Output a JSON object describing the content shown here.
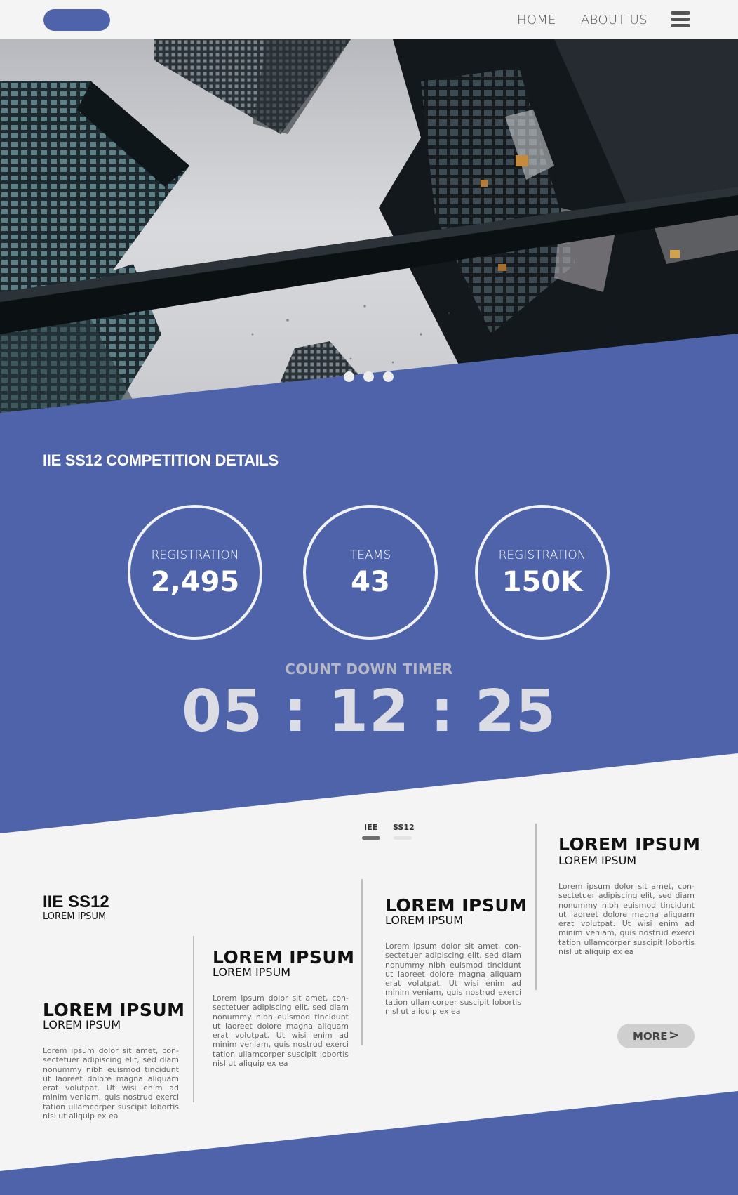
{
  "header": {
    "nav": [
      {
        "label": "HOME"
      },
      {
        "label": "ABOUT US"
      }
    ]
  },
  "hero": {
    "slide_count": 3
  },
  "colors": {
    "brand_blue": "#4f63aa",
    "background": "#f4f4f4"
  },
  "competition": {
    "title": "IIE SS12 COMPETITION DETAILS",
    "stats": [
      {
        "label": "REGISTRATION",
        "value": "2,495"
      },
      {
        "label": "TEAMS",
        "value": "43"
      },
      {
        "label": "REGISTRATION",
        "value": "150K"
      }
    ],
    "countdown": {
      "label": "COUNT DOWN TIMER",
      "value": "05 : 12 : 25"
    }
  },
  "tabs": [
    {
      "label": "IEE",
      "active": true
    },
    {
      "label": "SS12",
      "active": false
    }
  ],
  "intro": {
    "title": "IIE SS12",
    "subtitle": "LOREM IPSUM"
  },
  "columns": [
    {
      "heading": "LOREM IPSUM",
      "subheading": "LOREM IPSUM",
      "body": "Lorem ipsum dolor sit amet, con-sectetuer adipiscing elit, sed diam nonummy nibh euismod tincidunt ut laoreet dolore magna aliquam erat volutpat. Ut wisi enim ad minim veniam, quis nostrud exerci tation ullamcorper suscipit lobortis nisl ut aliquip ex ea"
    },
    {
      "heading": "LOREM IPSUM",
      "subheading": "LOREM IPSUM",
      "body": "Lorem ipsum dolor sit amet, con-sectetuer adipiscing elit, sed diam nonummy nibh euismod tincidunt ut laoreet dolore magna aliquam erat volutpat. Ut wisi enim ad minim veniam, quis nostrud exerci tation ullamcorper suscipit lobortis nisl ut aliquip ex ea"
    },
    {
      "heading": "LOREM IPSUM",
      "subheading": "LOREM IPSUM",
      "body": "Lorem ipsum dolor sit amet, con-sectetuer adipiscing elit, sed diam nonummy nibh euismod tincidunt ut laoreet dolore magna aliquam erat volutpat. Ut wisi enim ad minim veniam, quis nostrud exerci tation ullamcorper suscipit lobortis nisl ut aliquip ex ea"
    },
    {
      "heading": "LOREM IPSUM",
      "subheading": "LOREM IPSUM",
      "body": "Lorem ipsum dolor sit amet, con-sectetuer adipiscing elit, sed diam nonummy nibh euismod tincidunt ut laoreet dolore magna aliquam erat volutpat. Ut wisi enim ad minim veniam, quis nostrud exerci tation ullamcorper suscipit lobortis nisl ut aliquip ex ea"
    }
  ],
  "more_button": {
    "label": "MORE",
    "icon": "chevron-right-icon"
  }
}
